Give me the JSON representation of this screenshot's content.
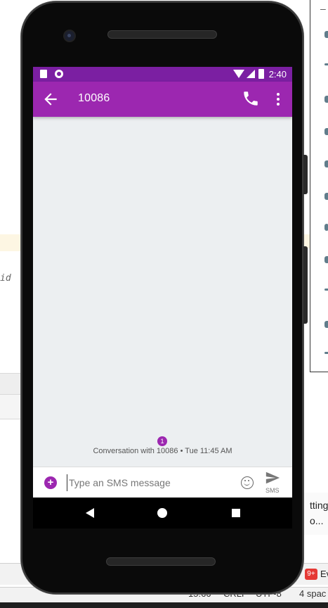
{
  "ide": {
    "left_fragment": "id",
    "right_bottom_line1": "tting",
    "right_bottom_line2": "o...",
    "event_badge": "9+",
    "event_text": "Ev",
    "status_items": [
      "15:66",
      "CRLF",
      "UTF-8",
      "4 spac"
    ]
  },
  "status_bar": {
    "time": "2:40"
  },
  "app_bar": {
    "title": "10086",
    "back_icon": "arrow-back-icon",
    "call_icon": "phone-icon",
    "more_icon": "more-vert-icon"
  },
  "conversation": {
    "badge": "1",
    "info": "Conversation with 10086 • Tue 11:45 AM"
  },
  "compose": {
    "placeholder": "Type an SMS message",
    "value": "",
    "send_label": "SMS"
  },
  "colors": {
    "status_bar": "#7b1fa2",
    "app_bar": "#9c27b0",
    "screen_bg": "#eceff1"
  }
}
